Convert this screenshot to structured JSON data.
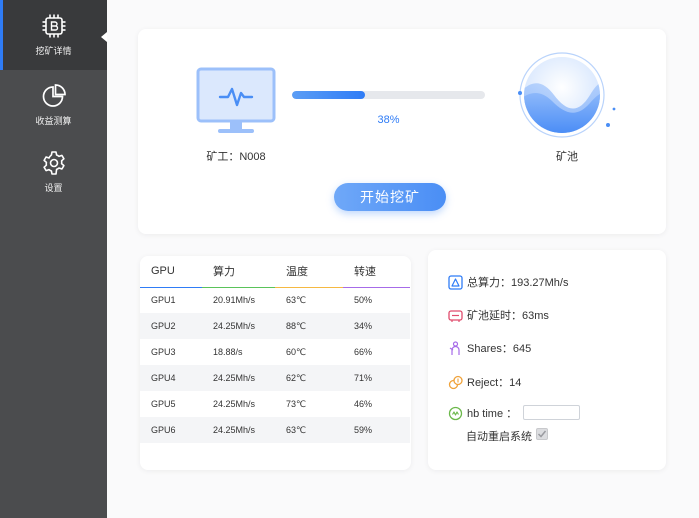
{
  "sidebar": {
    "items": [
      {
        "label": "挖矿详情",
        "icon": "chip-icon",
        "active": true
      },
      {
        "label": "收益测算",
        "icon": "pie-chart-icon",
        "active": false
      },
      {
        "label": "设置",
        "icon": "gear-icon",
        "active": false
      }
    ]
  },
  "mining": {
    "miner_label": "矿工：N008",
    "progress_percent": 38,
    "progress_text": "38%",
    "pool_label": "矿池",
    "start_button": "开始挖矿"
  },
  "gpu_table": {
    "headers": [
      "GPU",
      "算力",
      "温度",
      "转速"
    ],
    "rows": [
      [
        "GPU1",
        "20.91Mh/s",
        "63℃",
        "50%"
      ],
      [
        "GPU2",
        "24.25Mh/s",
        "88℃",
        "34%"
      ],
      [
        "GPU3",
        "18.88/s",
        "60℃",
        "66%"
      ],
      [
        "GPU4",
        "24.25Mh/s",
        "62℃",
        "71%"
      ],
      [
        "GPU5",
        "24.25Mh/s",
        "73℃",
        "46%"
      ],
      [
        "GPU6",
        "24.25Mh/s",
        "63℃",
        "59%"
      ]
    ]
  },
  "stats": {
    "total_hashrate": "总算力：193.27Mh/s",
    "pool_latency": "矿池延时：63ms",
    "shares": "Shares：645",
    "reject": "Reject：14",
    "hb_time_label": "hb time ：",
    "hb_time_value": "",
    "auto_restart_label": "自动重启系统",
    "auto_restart_checked": true
  },
  "colors": {
    "accent": "#2f7cf6",
    "sidebar_bg": "#4b4c4e",
    "sidebar_active_bg": "#393a3c"
  }
}
